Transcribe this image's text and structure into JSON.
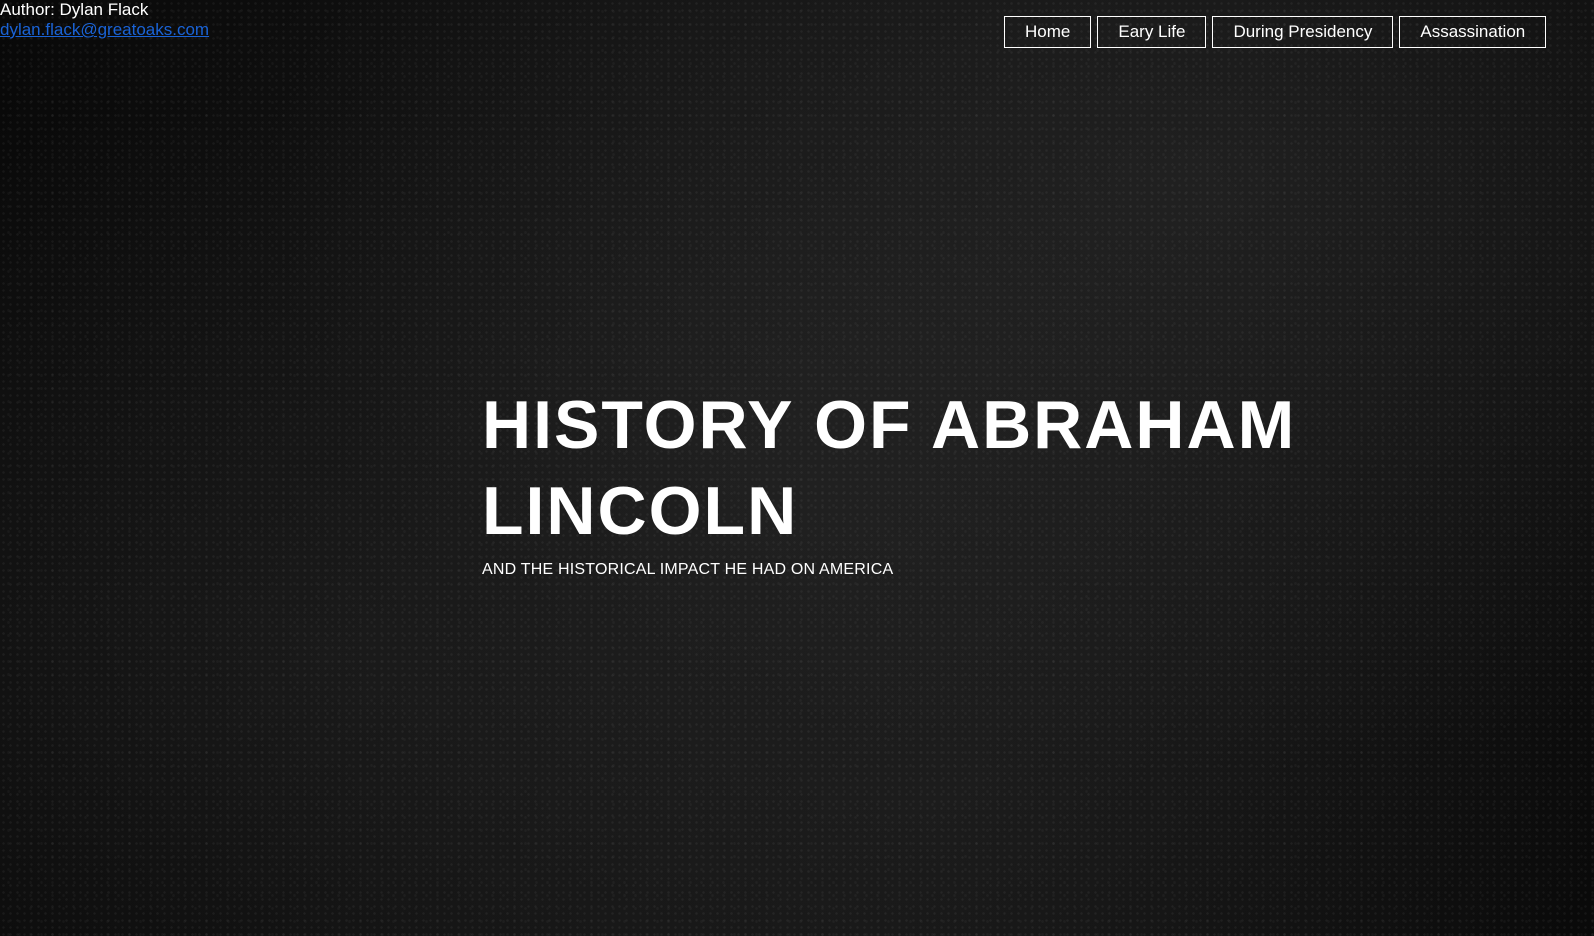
{
  "author": {
    "label": "Author: Dylan Flack",
    "email": "dylan.flack@greatoaks.com"
  },
  "nav": {
    "items": [
      {
        "label": "Home"
      },
      {
        "label": "Eary Life"
      },
      {
        "label": "During Presidency"
      },
      {
        "label": "Assassination"
      }
    ]
  },
  "hero": {
    "title": "HISTORY OF ABRAHAM LINCOLN",
    "subtitle": "AND THE HISTORICAL IMPACT HE HAD ON AMERICA"
  },
  "colors": {
    "background": "#0b0b0b",
    "text": "#ffffff",
    "link": "#1a63d6"
  }
}
